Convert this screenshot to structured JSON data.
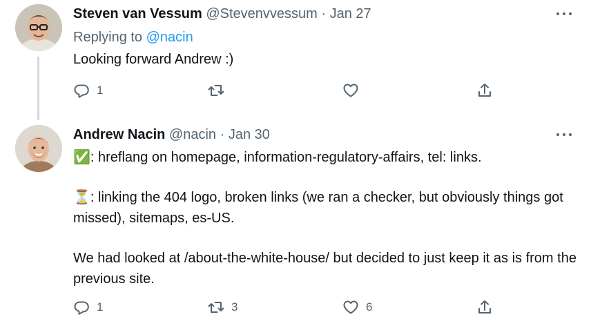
{
  "tweets": [
    {
      "name": "Steven van Vessum",
      "handle": "@Stevenvvessum",
      "sep": "·",
      "date": "Jan 27",
      "replying_label": "Replying to",
      "replying_handle": "@nacin",
      "text": "Looking forward Andrew :)",
      "reply_count": "1",
      "retweet_count": "",
      "like_count": ""
    },
    {
      "name": "Andrew Nacin",
      "handle": "@nacin",
      "sep": "·",
      "date": "Jan 30",
      "line1_emoji": "✅",
      "line1": ": hreflang on homepage, information-regulatory-affairs, tel: links.",
      "line2_emoji": "⏳",
      "line2": ": linking the 404 logo, broken links (we ran a checker, but obviously things got missed), sitemaps, es-US.",
      "line3": "We had looked at /about-the-white-house/ but decided to just keep it as is from the previous site.",
      "reply_count": "1",
      "retweet_count": "3",
      "like_count": "6"
    }
  ],
  "icons": {
    "reply": "reply-icon",
    "retweet": "retweet-icon",
    "like": "like-icon",
    "share": "share-icon",
    "more": "more-icon"
  },
  "colors": {
    "text": "#0f1419",
    "muted": "#536471",
    "link": "#1d9bf0",
    "thread_line": "#cfd9de",
    "check_green": "#5cb85c"
  }
}
